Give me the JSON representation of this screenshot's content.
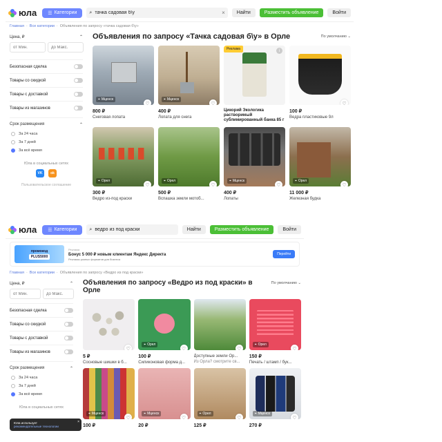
{
  "shot1": {
    "header": {
      "logo": "юла",
      "categories_label": "Категории",
      "search_value": "тачка садовая б\\у",
      "find_label": "Найти",
      "post_label": "Разместить объявление",
      "login_label": "Войти"
    },
    "breadcrumbs": [
      "Главная",
      "Все категории",
      "Объявления по запросу «тачка садовая б\\у»"
    ],
    "filters": {
      "price_title": "Цена, ₽",
      "price_from": "от Мин.",
      "price_to": "до Макс.",
      "toggles": [
        "Безопасная сделка",
        "Товары со скидкой",
        "Товары с доставкой",
        "Товары из магазинов"
      ],
      "period_title": "Срок размещения",
      "periods": [
        "За 24 часа",
        "За 7 дней",
        "За всё время"
      ],
      "social_title": "Юла в социальных сетях",
      "vk": "VK",
      "ok": "ok",
      "agreement": "Пользовательское соглашение"
    },
    "title": "Объявления по запросу «Тачка садовая б\\у» в Орле",
    "sort": "По умолчанию",
    "cards": [
      {
        "price": "800 ₽",
        "name": "Снеговая лопата",
        "loc": "Мценск"
      },
      {
        "price": "400 ₽",
        "name": "Лопата для снега",
        "loc": "Мценск"
      },
      {
        "price": "",
        "name": "Цикорий Экологика растворимый сублимированный банка 85 г",
        "loc": "",
        "ad": "Реклама"
      },
      {
        "price": "100 ₽",
        "name": "Ведра пластиковые 9л",
        "loc": ""
      },
      {
        "price": "300 ₽",
        "name": "Ведро из-под краски",
        "loc": "Орел"
      },
      {
        "price": "500 ₽",
        "name": "Вспашка земли мотоб...",
        "loc": "Орел"
      },
      {
        "price": "400 ₽",
        "name": "Лопаты",
        "loc": "Мценск"
      },
      {
        "price": "11 000 ₽",
        "name": "Железная будка",
        "loc": "Орел"
      }
    ]
  },
  "shot2": {
    "header": {
      "logo": "юла",
      "categories_label": "Категории",
      "search_value": "ведро из под краски",
      "find_label": "Найти",
      "post_label": "Разместить объявление",
      "login_label": "Войти"
    },
    "banner": {
      "meta": "Реклама",
      "promo_label": "промокод",
      "promo_code": "PLUS5000",
      "title": "Бонус 5 000 ₽ новым клиентам Яндекс Директа",
      "desc": "Рекламы разных форматов для бизнеса",
      "go": "Перейти"
    },
    "breadcrumbs": [
      "Главная",
      "Все категории",
      "Объявления по запросу «Ведро из под краски»"
    ],
    "filters": {
      "price_title": "Цена, ₽",
      "price_from": "от Мин.",
      "price_to": "до Макс.",
      "toggles": [
        "Безопасная сделка",
        "Товары со скидкой",
        "Товары с доставкой",
        "Товары из магазинов"
      ],
      "period_title": "Срок размещения",
      "periods": [
        "За 24 часа",
        "За 7 дней",
        "За всё время"
      ],
      "social_title": "Юла в социальных сетях"
    },
    "title": "Объявления по запросу «Ведро из под краски» в Орле",
    "sort": "По умолчанию",
    "cards": [
      {
        "price": "5 ₽",
        "name": "Сосновые шишки в б...",
        "loc": ""
      },
      {
        "price": "100 ₽",
        "name": "Силиконовая форма д...",
        "loc": "Орел"
      },
      {
        "price": "",
        "name": "Доступные земли Ор...",
        "sub": "Из Орла? смотрите св...",
        "loc": ""
      },
      {
        "price": "150 ₽",
        "name": "Печать / штамп / бук...",
        "loc": "Орел"
      },
      {
        "price": "100 ₽",
        "name": "",
        "loc": "Мценск"
      },
      {
        "price": "20 ₽",
        "name": "",
        "loc": "Мценск"
      },
      {
        "price": "125 ₽",
        "name": "",
        "loc": "Орел"
      },
      {
        "price": "270 ₽",
        "name": "",
        "loc": "Мценск"
      }
    ],
    "cookie": {
      "text": "Юла использует",
      "link": "рекомендательные технологии",
      "close": "×"
    }
  }
}
